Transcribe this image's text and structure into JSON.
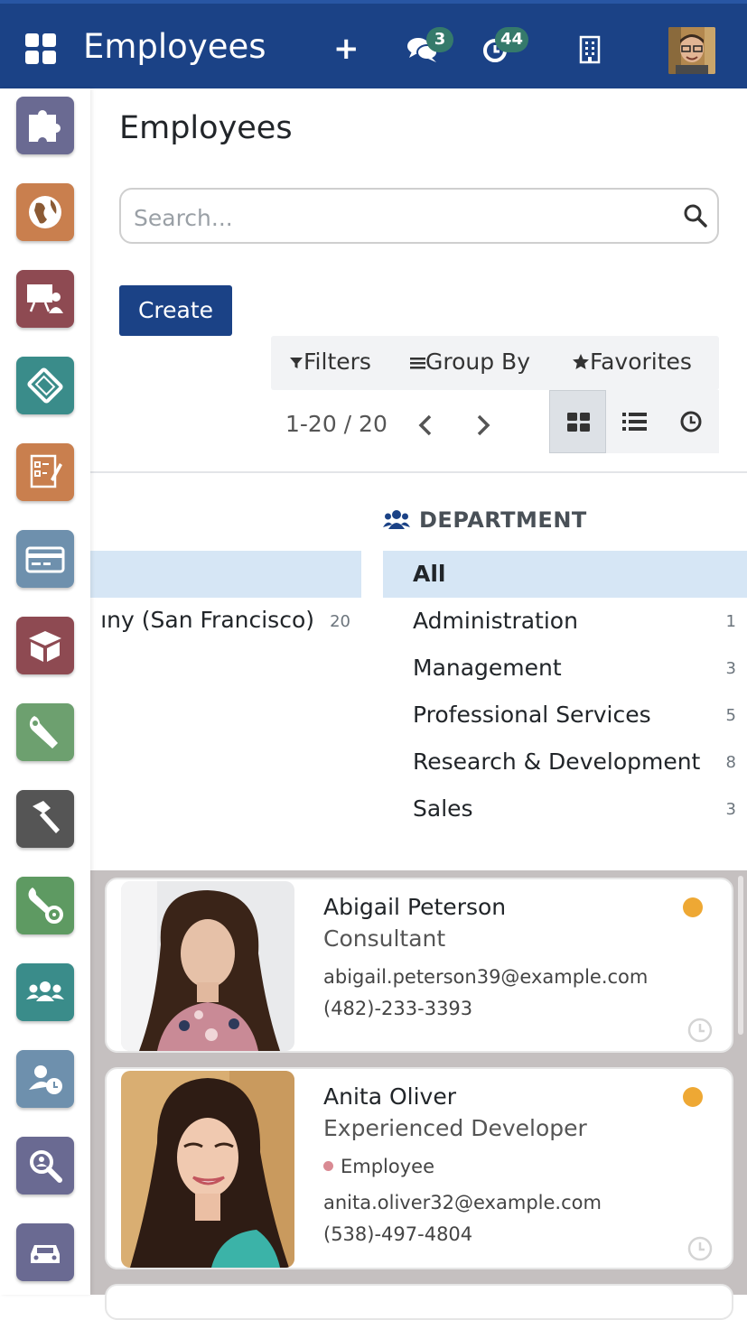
{
  "navbar": {
    "title": "Employees",
    "plus_label": "+",
    "chat_badge": "3",
    "activity_badge": "44",
    "colors": {
      "bar": "#1b4286",
      "badge": "#357a6b"
    }
  },
  "sidebar": {
    "apps": [
      {
        "icon": "puzzle-icon",
        "color": "#6a6a92"
      },
      {
        "icon": "globe-icon",
        "color": "#c97f4e"
      },
      {
        "icon": "presentation-icon",
        "color": "#8e4a52"
      },
      {
        "icon": "ticket-icon",
        "color": "#3a8c8a"
      },
      {
        "icon": "survey-icon",
        "color": "#c97f4e"
      },
      {
        "icon": "card-icon",
        "color": "#6e90ad"
      },
      {
        "icon": "box-icon",
        "color": "#8e4a52"
      },
      {
        "icon": "wrench-icon",
        "color": "#6da06f"
      },
      {
        "icon": "hammer-icon",
        "color": "#555555"
      },
      {
        "icon": "wrench-gear-icon",
        "color": "#5e9a62"
      },
      {
        "icon": "team-icon",
        "color": "#3a8c8a"
      },
      {
        "icon": "user-clock-icon",
        "color": "#6e90ad"
      },
      {
        "icon": "magnifier-icon",
        "color": "#6a6a92"
      },
      {
        "icon": "car-icon",
        "color": "#6a6a92"
      }
    ]
  },
  "control": {
    "page_title": "Employees",
    "search_placeholder": "Search...",
    "create_label": "Create",
    "filters_label": "Filters",
    "groupby_label": "Group By",
    "favorites_label": "Favorites",
    "pager": "1-20 / 20"
  },
  "search_panel": {
    "company_label": "ıny (San Francisco)",
    "company_count": "20",
    "department_header": "DEPARTMENT",
    "departments": [
      {
        "label": "All",
        "count": ""
      },
      {
        "label": "Administration",
        "count": "1"
      },
      {
        "label": "Management",
        "count": "3"
      },
      {
        "label": "Professional Services",
        "count": "5"
      },
      {
        "label": "Research & Development",
        "count": "8"
      },
      {
        "label": "Sales",
        "count": "3"
      }
    ]
  },
  "employees": [
    {
      "name": "Abigail Peterson",
      "job": "Consultant",
      "tag": "",
      "email": "abigail.peterson39@example.com",
      "phone": "(482)-233-3393",
      "presence_color": "#eea834"
    },
    {
      "name": "Anita Oliver",
      "job": "Experienced Developer",
      "tag": "Employee",
      "email": "anita.oliver32@example.com",
      "phone": "(538)-497-4804",
      "presence_color": "#eea834"
    }
  ]
}
